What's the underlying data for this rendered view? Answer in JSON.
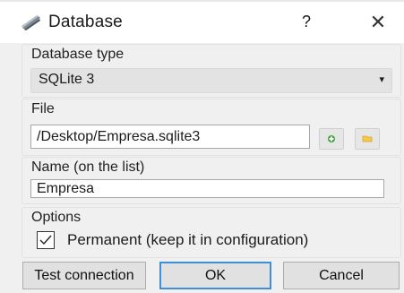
{
  "window": {
    "title": "Database",
    "help_label": "?",
    "close_label": "✕"
  },
  "database_type": {
    "group_label": "Database type",
    "selected": "SQLite 3",
    "arrow": "▾"
  },
  "file": {
    "group_label": "File",
    "value": "/Desktop/Empresa.sqlite3"
  },
  "name": {
    "group_label": "Name (on the list)",
    "value": "Empresa"
  },
  "options": {
    "group_label": "Options",
    "permanent_label": "Permanent (keep it in configuration)",
    "permanent_checked": true
  },
  "buttons": {
    "test": "Test connection",
    "ok": "OK",
    "cancel": "Cancel"
  },
  "colors": {
    "default_button_border": "#3f8fd6",
    "new_file_icon": "#3aa63a",
    "folder_icon": "#f2c94c"
  }
}
